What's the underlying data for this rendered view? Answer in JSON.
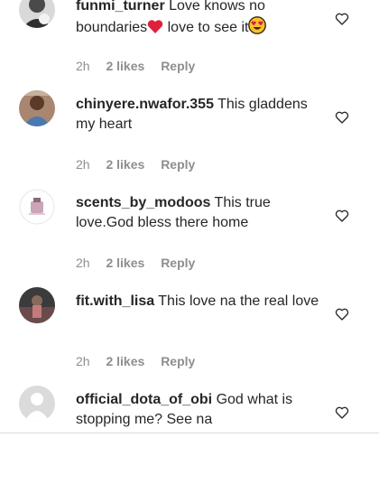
{
  "comments": [
    {
      "username": "funmi_turner",
      "text_parts": [
        "Love knows no boundaries",
        " love to see it"
      ],
      "emojis": [
        "red-heart",
        "heart-eyes-face"
      ],
      "time": "2h",
      "likes": "2 likes",
      "reply": "Reply"
    },
    {
      "username": "chinyere.nwafor.355",
      "text": "This gladdens my heart",
      "time": "2h",
      "likes": "2 likes",
      "reply": "Reply"
    },
    {
      "username": "scents_by_modoos",
      "text": "This true love.God bless there home",
      "time": "2h",
      "likes": "2 likes",
      "reply": "Reply"
    },
    {
      "username": "fit.with_lisa",
      "text": "This love na the real love",
      "time": "2h",
      "likes": "2 likes",
      "reply": "Reply"
    },
    {
      "username": "official_dota_of_obi",
      "text": "God what is stopping me? See na",
      "time": "",
      "likes": "",
      "reply": ""
    }
  ],
  "icons": {
    "like": "heart-outline-icon",
    "default_avatar": "person-icon"
  },
  "colors": {
    "text": "#262626",
    "meta": "#8e8e8e",
    "heart_emoji": "#e0203a",
    "emoji_face": "#f9c22e"
  }
}
